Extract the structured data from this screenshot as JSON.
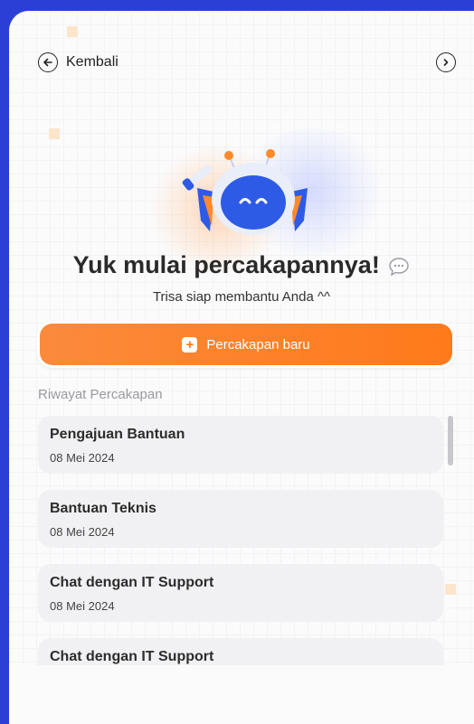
{
  "header": {
    "back_label": "Kembali",
    "back_icon": "arrow-left-circle-icon",
    "forward_icon": "chevron-right-circle-icon"
  },
  "hero": {
    "mascot": "robot-mascot",
    "headline": "Yuk mulai percakapannya!",
    "headline_icon": "speech-bubble-icon",
    "subtitle": "Trisa siap membantu Anda ^^"
  },
  "new_chat": {
    "label": "Percakapan baru",
    "icon": "plus-square-icon"
  },
  "history": {
    "label": "Riwayat Percakapan",
    "items": [
      {
        "title": "Pengajuan Bantuan",
        "date": "08 Mei 2024"
      },
      {
        "title": "Bantuan Teknis",
        "date": "08 Mei 2024"
      },
      {
        "title": "Chat dengan IT Support",
        "date": "08 Mei 2024"
      },
      {
        "title": "Chat dengan IT Support",
        "date": ""
      }
    ]
  },
  "colors": {
    "accent": "#ff7a1a",
    "frame": "#2b3fd6",
    "card": "#f1f1f3",
    "robot_blue": "#2e5be6"
  }
}
